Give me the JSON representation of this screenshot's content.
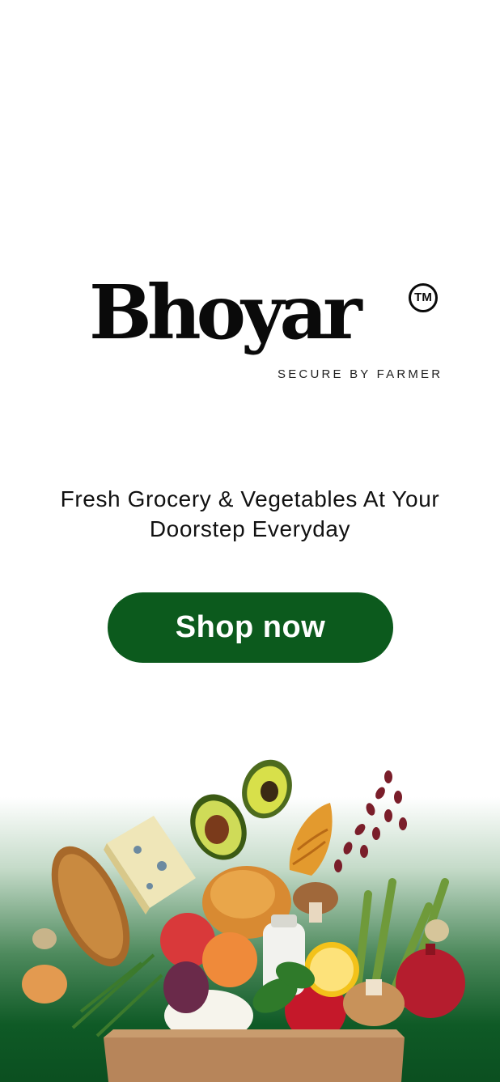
{
  "brand": {
    "name": "Bhoyar",
    "trademark": "TM",
    "tagline": "SECURE BY FARMER"
  },
  "hero": {
    "headline_line1": "Fresh Grocery & Vegetables At Your",
    "headline_line2": "Doorstep Everyday"
  },
  "cta": {
    "label": "Shop now"
  },
  "colors": {
    "brand_green": "#0c5a1d",
    "text": "#111111",
    "background": "#ffffff"
  }
}
